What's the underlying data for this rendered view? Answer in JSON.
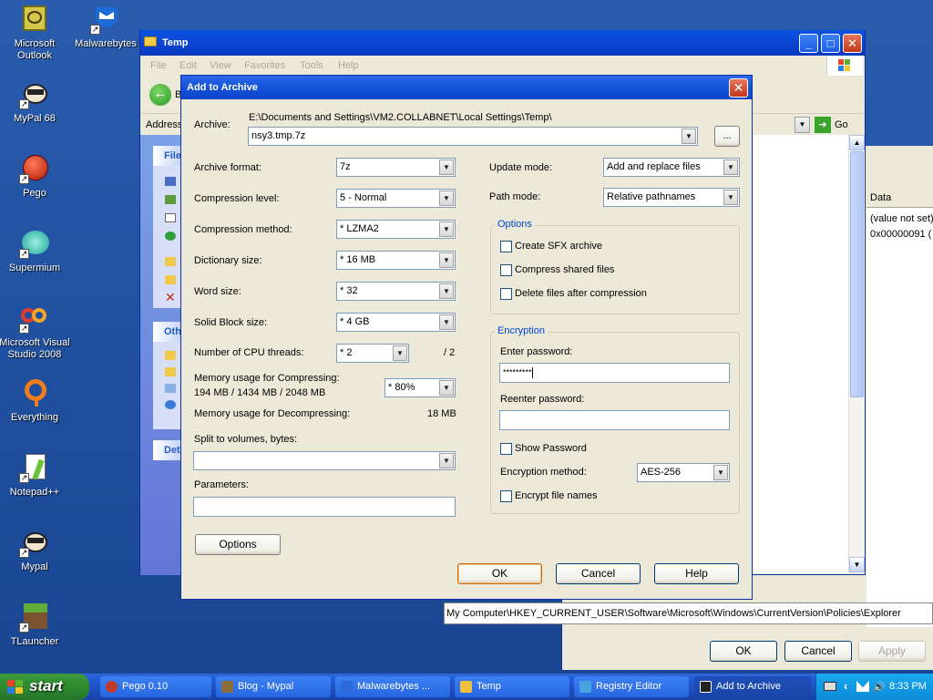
{
  "desktop_icons": [
    {
      "label": "Microsoft Outlook",
      "icon": "outlook-icon"
    },
    {
      "label": "Malwarebytes",
      "icon": "malwarebytes-icon"
    },
    {
      "label": "MyPal 68",
      "icon": "mypal-icon"
    },
    {
      "label": "Pego",
      "icon": "pego-icon"
    },
    {
      "label": "Supermium",
      "icon": "supermium-icon"
    },
    {
      "label": "Microsoft Visual Studio 2008",
      "icon": "visual-studio-icon"
    },
    {
      "label": "Everything",
      "icon": "everything-icon"
    },
    {
      "label": "Notepad++",
      "icon": "notepadpp-icon"
    },
    {
      "label": "Mypal",
      "icon": "mypal-icon"
    },
    {
      "label": "TLauncher",
      "icon": "tlauncher-icon"
    }
  ],
  "explorer": {
    "title": "Temp",
    "menu": [
      "File",
      "Edit",
      "View",
      "Favorites",
      "Tools",
      "Help"
    ],
    "back_label": "B",
    "address_label": "Address",
    "go_label": "Go",
    "panel_heads": [
      "File",
      "Oth",
      "Det"
    ]
  },
  "registry": {
    "data_header": "Data",
    "rows": [
      "(value not set)",
      "0x00000091 ("
    ],
    "status_path": "My Computer\\HKEY_CURRENT_USER\\Software\\Microsoft\\Windows\\CurrentVersion\\Policies\\Explorer",
    "ok_label": "OK",
    "cancel_label": "Cancel",
    "apply_label": "Apply"
  },
  "dialog": {
    "title": "Add to Archive",
    "archive_label": "Archive:",
    "archive_path": "E:\\Documents and Settings\\VM2.COLLABNET\\Local Settings\\Temp\\",
    "archive_name": "nsy3.tmp.7z",
    "browse_label": "...",
    "archive_format_label": "Archive format:",
    "archive_format": "7z",
    "compression_level_label": "Compression level:",
    "compression_level": "5 - Normal",
    "compression_method_label": "Compression method:",
    "compression_method": "* LZMA2",
    "dictionary_size_label": "Dictionary size:",
    "dictionary_size": "* 16 MB",
    "word_size_label": "Word size:",
    "word_size": "* 32",
    "solid_block_label": "Solid Block size:",
    "solid_block": "* 4 GB",
    "cpu_threads_label": "Number of CPU threads:",
    "cpu_threads": "* 2",
    "cpu_threads_max": "/ 2",
    "mem_compress_label": "Memory usage for Compressing:",
    "mem_compress_values": "194 MB / 1434 MB / 2048 MB",
    "mem_compress_pct": "* 80%",
    "mem_decompress_label": "Memory usage for Decompressing:",
    "mem_decompress_value": "18 MB",
    "split_label": "Split to volumes, bytes:",
    "split_value": "",
    "parameters_label": "Parameters:",
    "parameters_value": "",
    "options_button": "Options",
    "update_mode_label": "Update mode:",
    "update_mode": "Add and replace files",
    "path_mode_label": "Path mode:",
    "path_mode": "Relative pathnames",
    "options_group": "Options",
    "create_sfx": "Create SFX archive",
    "compress_shared": "Compress shared files",
    "delete_after": "Delete files after compression",
    "encryption_group": "Encryption",
    "enter_password_label": "Enter password:",
    "password_value": "*********",
    "reenter_password_label": "Reenter password:",
    "reenter_value": "",
    "show_password": "Show Password",
    "encryption_method_label": "Encryption method:",
    "encryption_method": "AES-256",
    "encrypt_names": "Encrypt file names",
    "ok": "OK",
    "cancel": "Cancel",
    "help": "Help"
  },
  "taskbar": {
    "start": "start",
    "tasks": [
      {
        "label": "Pego 0.10",
        "color": "#c0392b"
      },
      {
        "label": "Blog - Mypal",
        "color": "#8a6d3b"
      },
      {
        "label": "Malwarebytes ...",
        "color": "#2e6bd8"
      },
      {
        "label": "Temp",
        "color": "#f0c040"
      },
      {
        "label": "Registry Editor",
        "color": "#4aa3df"
      },
      {
        "label": "Add to Archive",
        "color": "#222222"
      }
    ],
    "clock": "8:33 PM"
  }
}
